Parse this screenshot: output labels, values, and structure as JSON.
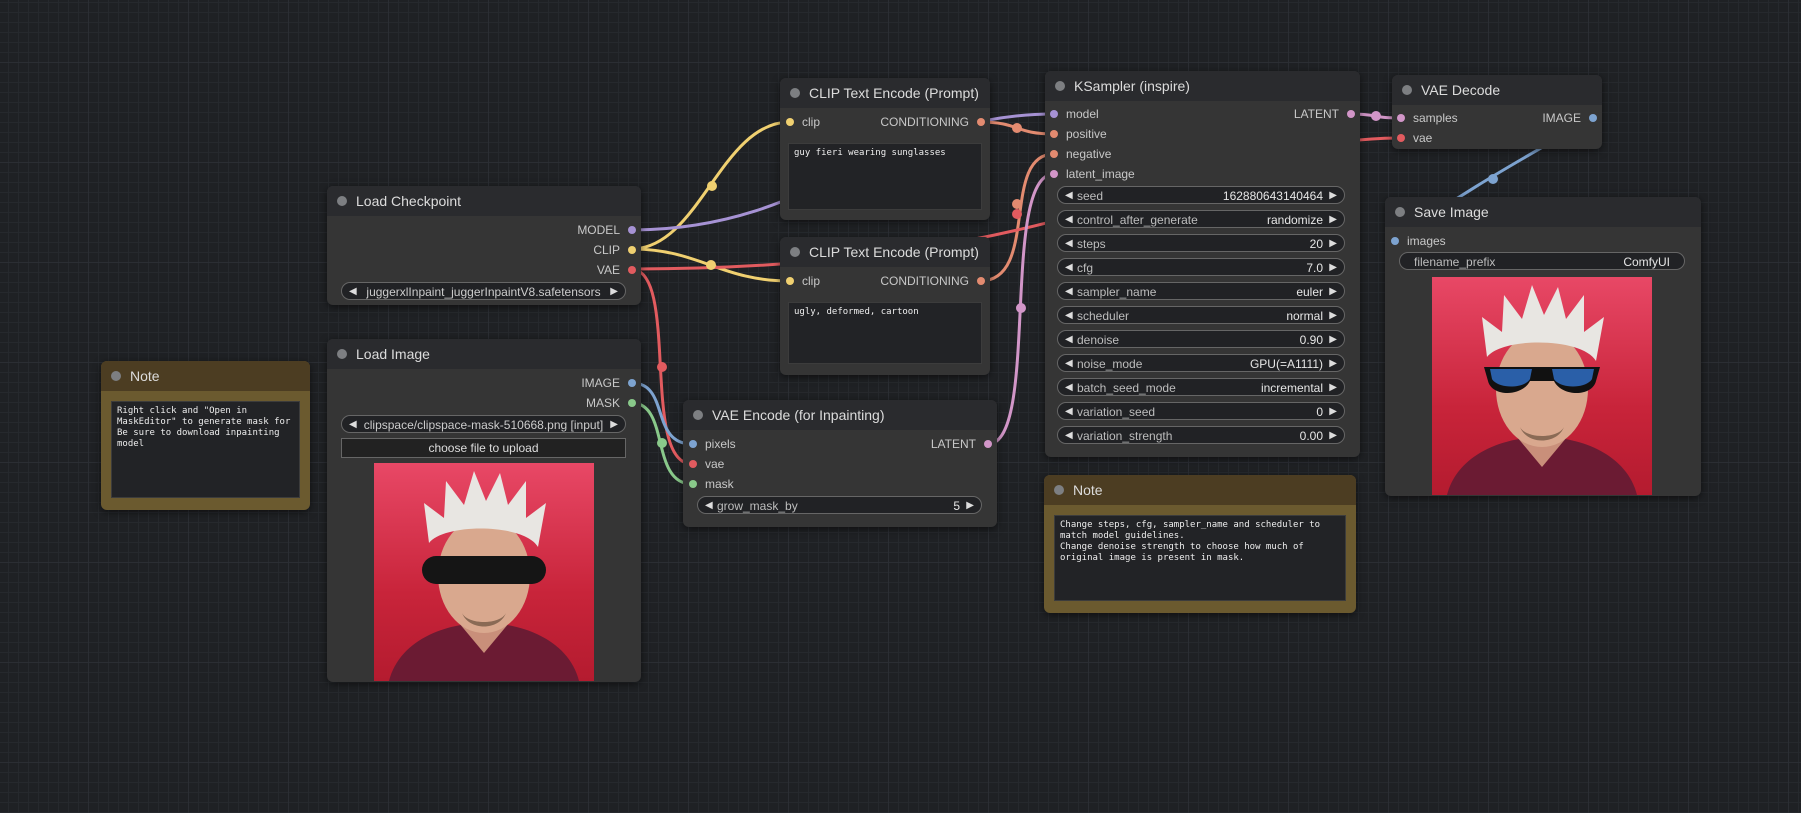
{
  "colors": {
    "canvas": "#1f2124",
    "node_bg": "#353535",
    "node_title": "#2a2b2e",
    "note_bg": "#6b5a2f",
    "clip_wire": "#f0d070",
    "model_wire": "#a692d4",
    "cond_wire": "#e38b70",
    "vae_wire": "#e25b5f",
    "latent_wire": "#d296c8",
    "image_wire": "#7da3d0",
    "mask_wire": "#89c98a"
  },
  "note1": {
    "title": "Note",
    "text": "Right click and \"Open in MaskEditor\" to generate mask for Be sure to download inpainting model"
  },
  "load_checkpoint": {
    "title": "Load Checkpoint",
    "outputs": [
      "MODEL",
      "CLIP",
      "VAE"
    ],
    "ckpt_name": "juggerxlInpaint_juggerInpaintV8.safetensors"
  },
  "load_image": {
    "title": "Load Image",
    "outputs": [
      "IMAGE",
      "MASK"
    ],
    "image": "clipspace/clipspace-mask-510668.png [input]",
    "upload_label": "choose file to upload"
  },
  "clip_pos": {
    "title": "CLIP Text Encode (Prompt)",
    "input": "clip",
    "output": "CONDITIONING",
    "text": "guy fieri wearing sunglasses"
  },
  "clip_neg": {
    "title": "CLIP Text Encode (Prompt)",
    "input": "clip",
    "output": "CONDITIONING",
    "text": "ugly, deformed, cartoon"
  },
  "vae_encode": {
    "title": "VAE Encode (for Inpainting)",
    "inputs": [
      "pixels",
      "vae",
      "mask"
    ],
    "output": "LATENT",
    "grow_label": "grow_mask_by",
    "grow_value": "5"
  },
  "ksampler": {
    "title": "KSampler (inspire)",
    "inputs": [
      "model",
      "positive",
      "negative",
      "latent_image"
    ],
    "output": "LATENT",
    "widgets": [
      {
        "label": "seed",
        "value": "162880643140464"
      },
      {
        "label": "control_after_generate",
        "value": "randomize"
      },
      {
        "label": "steps",
        "value": "20"
      },
      {
        "label": "cfg",
        "value": "7.0"
      },
      {
        "label": "sampler_name",
        "value": "euler"
      },
      {
        "label": "scheduler",
        "value": "normal"
      },
      {
        "label": "denoise",
        "value": "0.90"
      },
      {
        "label": "noise_mode",
        "value": "GPU(=A1111)"
      },
      {
        "label": "batch_seed_mode",
        "value": "incremental"
      },
      {
        "label": "variation_seed",
        "value": "0"
      },
      {
        "label": "variation_strength",
        "value": "0.00"
      }
    ]
  },
  "note2": {
    "title": "Note",
    "text": "Change steps, cfg, sampler_name and scheduler to match model guidelines.\nChange denoise strength to choose how much of original image is present in mask."
  },
  "vae_decode": {
    "title": "VAE Decode",
    "inputs": [
      "samples",
      "vae"
    ],
    "output": "IMAGE"
  },
  "save_image": {
    "title": "Save Image",
    "input": "images",
    "prefix_label": "filename_prefix",
    "prefix_value": "ComfyUI"
  }
}
